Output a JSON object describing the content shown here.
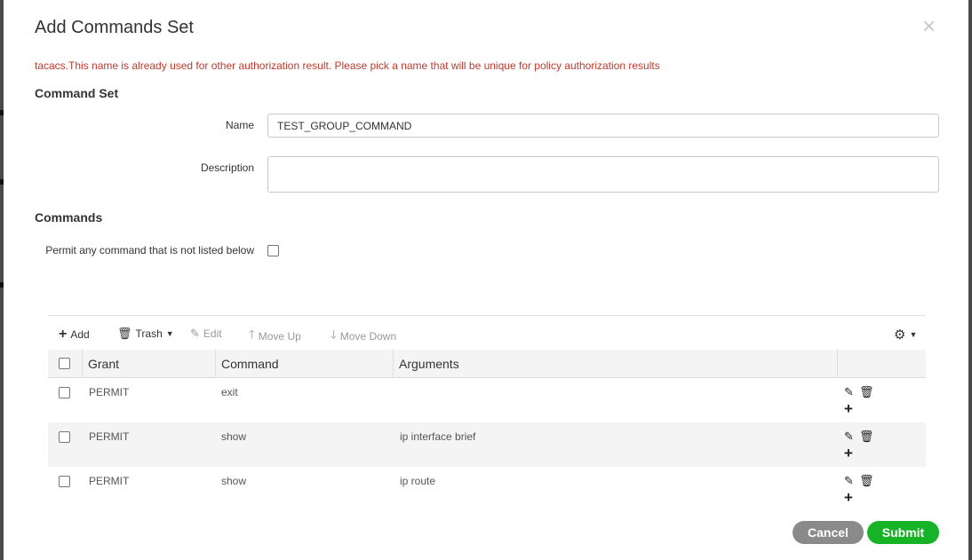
{
  "dialog": {
    "title": "Add Commands Set",
    "close_symbol": "×",
    "error": "tacacs.This name is already used for other authorization result. Please pick a name that will be unique for policy authorization results"
  },
  "command_set": {
    "heading": "Command Set",
    "name_label": "Name",
    "name_value": "TEST_GROUP_COMMAND",
    "description_label": "Description",
    "description_value": ""
  },
  "commands": {
    "heading": "Commands",
    "permit_any_label": "Permit any command that is not listed below",
    "permit_any_checked": false
  },
  "toolbar": {
    "add": "Add",
    "trash": "Trash",
    "edit": "Edit",
    "move_up": "Move Up",
    "move_down": "Move Down"
  },
  "table": {
    "columns": [
      "Grant",
      "Command",
      "Arguments"
    ],
    "rows": [
      {
        "grant": "PERMIT",
        "command": "exit",
        "arguments": ""
      },
      {
        "grant": "PERMIT",
        "command": "show",
        "arguments": "ip interface brief"
      },
      {
        "grant": "PERMIT",
        "command": "show",
        "arguments": "ip route"
      }
    ]
  },
  "footer": {
    "cancel": "Cancel",
    "submit": "Submit"
  },
  "icons": {
    "add": "plus-icon",
    "trash": "trash-icon",
    "edit": "edit-icon",
    "move_up": "arrow-up-icon",
    "move_down": "arrow-down-icon",
    "settings": "gear-icon"
  },
  "colors": {
    "error": "#c0392b",
    "submit": "#17b326",
    "cancel": "#8a8a8a"
  }
}
